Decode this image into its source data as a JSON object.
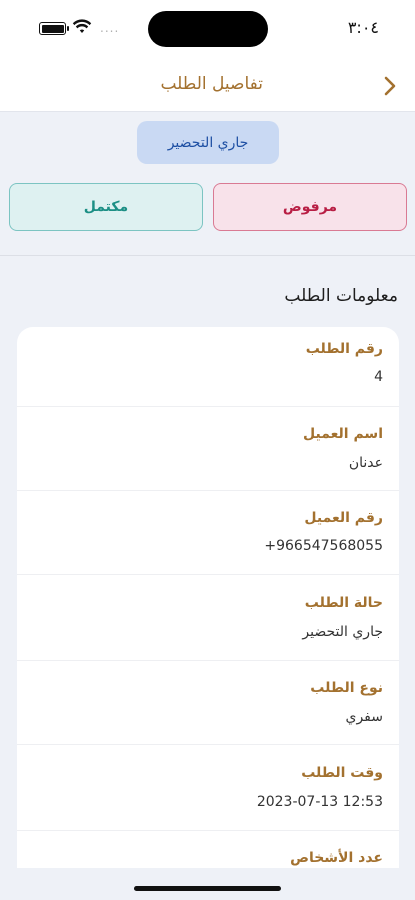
{
  "status_bar": {
    "time": "٣:٠٤",
    "signal_dots": "...."
  },
  "nav": {
    "title": "تفاصيل الطلب",
    "back_icon": "chevron-right-icon"
  },
  "order_status_pill": "جاري التحضير",
  "actions": {
    "rejected_label": "مرفوض",
    "completed_label": "مكتمل"
  },
  "colors": {
    "accent_gold": "#a3712f",
    "pill_bg": "#c9d9f3",
    "rejected": "#b81e44",
    "completed": "#1c8f85"
  },
  "section_title": "معلومات الطلب",
  "details": [
    {
      "label": "رقم الطلب",
      "value": "4"
    },
    {
      "label": "اسم العميل",
      "value": "عدنان"
    },
    {
      "label": "رقم العميل",
      "value": "+966547568055"
    },
    {
      "label": "حالة الطلب",
      "value": "جاري التحضير"
    },
    {
      "label": "نوع الطلب",
      "value": "سفري"
    },
    {
      "label": "وقت الطلب",
      "value": "2023-07-13 12:53"
    },
    {
      "label": "عدد الأشخاص",
      "value": ""
    }
  ]
}
